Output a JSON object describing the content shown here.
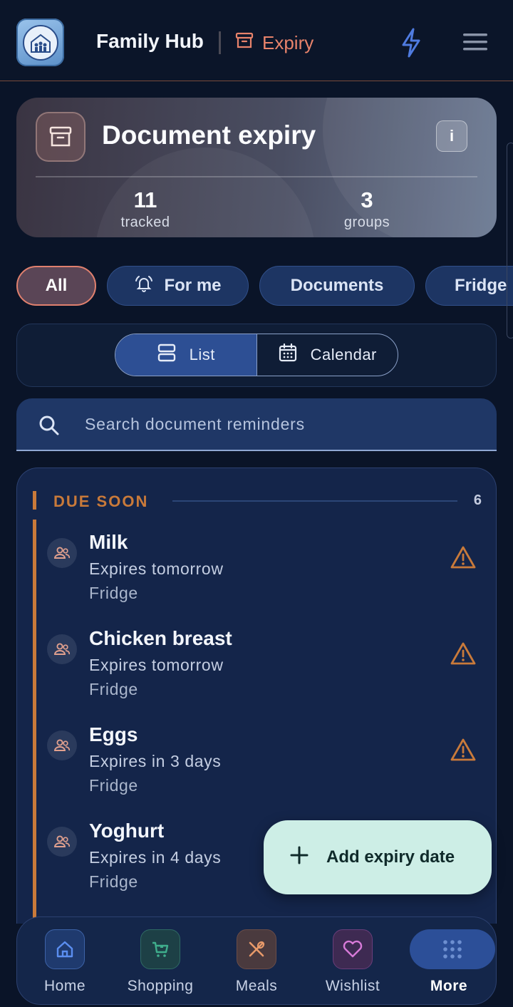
{
  "header": {
    "app_title": "Family Hub",
    "section_label": "Expiry"
  },
  "hero": {
    "title": "Document expiry",
    "info_label": "i",
    "stats": [
      {
        "value": "11",
        "label": "tracked"
      },
      {
        "value": "3",
        "label": "groups"
      }
    ]
  },
  "filters": [
    {
      "label": "All",
      "active": true
    },
    {
      "label": "For me",
      "active": false
    },
    {
      "label": "Documents",
      "active": false
    },
    {
      "label": "Fridge",
      "active": false
    }
  ],
  "view_toggle": {
    "list_label": "List",
    "calendar_label": "Calendar",
    "selected": "List"
  },
  "search": {
    "placeholder": "Search document reminders",
    "value": ""
  },
  "group": {
    "title": "DUE SOON",
    "count": "6",
    "items": [
      {
        "name": "Milk",
        "status": "Expires tomorrow",
        "category": "Fridge",
        "warning": true
      },
      {
        "name": "Chicken breast",
        "status": "Expires tomorrow",
        "category": "Fridge",
        "warning": true
      },
      {
        "name": "Eggs",
        "status": "Expires in 3 days",
        "category": "Fridge",
        "warning": true
      },
      {
        "name": "Yoghurt",
        "status": "Expires in 4 days",
        "category": "Fridge",
        "warning": false
      }
    ]
  },
  "fab": {
    "label": "Add expiry date"
  },
  "bottom_nav": [
    {
      "label": "Home",
      "icon": "home-icon"
    },
    {
      "label": "Shopping",
      "icon": "cart-icon"
    },
    {
      "label": "Meals",
      "icon": "utensils-icon"
    },
    {
      "label": "Wishlist",
      "icon": "heart-icon"
    },
    {
      "label": "More",
      "icon": "grid-icon",
      "active": true
    }
  ],
  "colors": {
    "background": "#0a1428",
    "accent_orange": "#c97a3a",
    "accent_coral": "#e8836b",
    "primary_blue": "#2d4f94",
    "fab_bg": "#cdeee6"
  }
}
